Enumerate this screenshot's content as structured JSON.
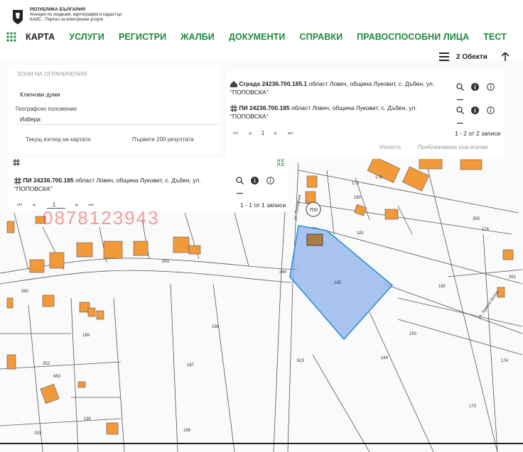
{
  "header": {
    "logo_title": "РЕПУБЛИКА БЪЛГАРИЯ",
    "logo_sub1": "Агенция по геодезия, картография и кадастър",
    "logo_sub2": "КАИС - Портал за електронни услуги"
  },
  "nav": {
    "items": [
      "КАРТА",
      "УСЛУГИ",
      "РЕГИСТРИ",
      "ЖАЛБИ",
      "ДОКУМЕНТИ",
      "СПРАВКИ",
      "ПРАВОСПОСОБНИ ЛИЦА",
      "ТЕСТ"
    ],
    "active": "КАРТА"
  },
  "objects": {
    "label": "2 Обекти"
  },
  "filters": {
    "title": "ЗОНИ НА ОГРАНИЧЕНИЯ",
    "keywords_label": "Ключови думи",
    "geo_label": "Географско положение",
    "geo_value": "Избери",
    "option1": "Текущ изглед на картата",
    "option2": "Първите 200 резултата"
  },
  "results": {
    "items": [
      {
        "title": "Сграда 24236.700.185.1",
        "address": "област Ловеч, община Луковит, с. Дъбен, ул. \"ПОПОВСКА\"",
        "icon": "building-icon"
      },
      {
        "title": "ПИ 24236.700.185",
        "address": "област Ловеч, община Луковит, с. Дъбен, ул. \"ПОПОВСКА\"",
        "icon": "parcel-icon"
      }
    ],
    "page": "1",
    "count": "1 - 2 от 2 записи",
    "clear": "Изчисти",
    "zoom_all": "Приближаване към всички"
  },
  "lower_results": {
    "item": {
      "title": "ПИ 24236.700.185",
      "address": "област Ловеч, община Луковит, с. Дъбен, ул. \"ПОПОВСКА\""
    },
    "page": "1",
    "count": "1 - 1 от 1 записи"
  },
  "watermark": "0878123943",
  "map": {
    "highlight_color": "#7fa6e8",
    "building_color": "#f29a3a",
    "parcel_numbers": [
      "179",
      "180",
      "178",
      "181",
      "176",
      "350",
      "185",
      "182",
      "186",
      "187",
      "183",
      "184",
      "174",
      "173",
      "189",
      "190",
      "191",
      "188",
      "623",
      "663",
      "343",
      "342",
      "344",
      "351",
      "352"
    ],
    "street_labels": [
      "ул. Поповска",
      "ул. Христо Ботев"
    ],
    "badge": "700"
  }
}
